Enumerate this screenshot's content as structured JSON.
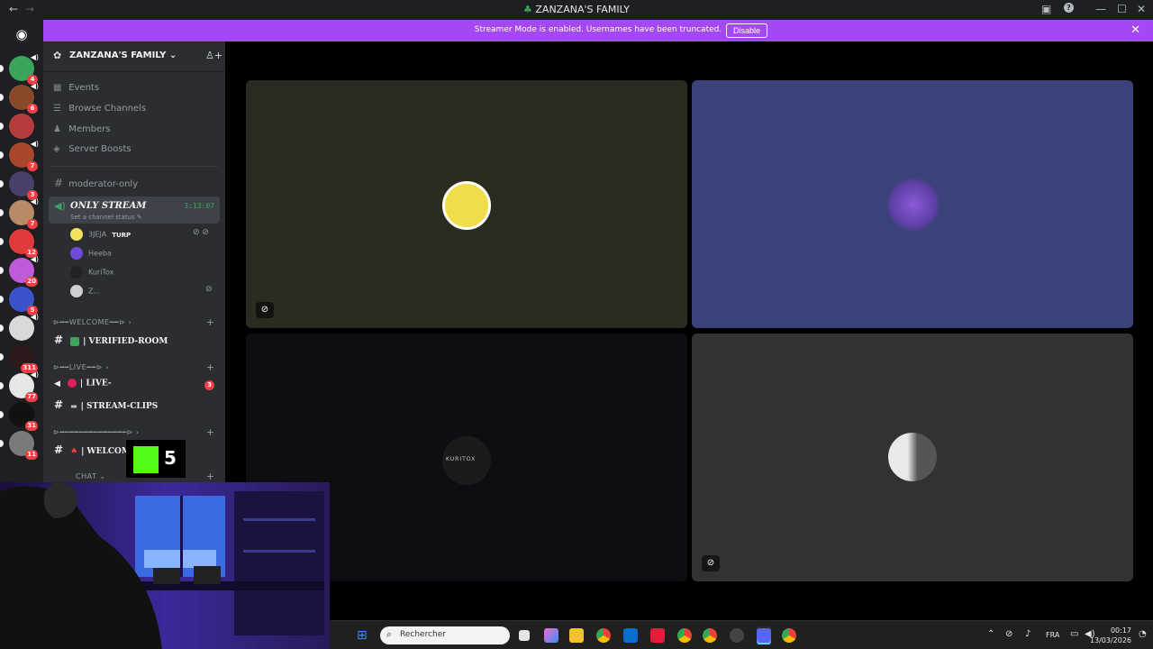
{
  "window": {
    "title": "ZANZANA'S FAMILY",
    "back_icon": "←",
    "forward_icon": "→",
    "help_icon": "?",
    "minimize_icon": "—",
    "maximize_icon": "☐",
    "close_icon": "✕"
  },
  "banner": {
    "message": "Streamer Mode is enabled. Usernames have been truncated.",
    "button": "Disable",
    "close": "✕",
    "color": "#a348f2"
  },
  "servers": [
    {
      "badge": "4",
      "color": "#3ba55c",
      "speaker": true
    },
    {
      "badge": "6",
      "color": "#8a4a2a",
      "speaker": true
    },
    {
      "badge": "",
      "color": "#b43c3c",
      "speaker": false
    },
    {
      "badge": "7",
      "color": "#a8472d",
      "speaker": true
    },
    {
      "badge": "3",
      "color": "#4a3f6b",
      "speaker": false
    },
    {
      "badge": "7",
      "color": "#b88a66",
      "speaker": true
    },
    {
      "badge": "12",
      "color": "#e03a3a",
      "speaker": false
    },
    {
      "badge": "20",
      "color": "#c05ad8",
      "speaker": true
    },
    {
      "badge": "5",
      "color": "#3b52c8",
      "speaker": false
    },
    {
      "badge": "",
      "color": "#d9d9d9",
      "speaker": true
    },
    {
      "badge": "311",
      "color": "#2b1a1a",
      "speaker": false
    },
    {
      "badge": "77",
      "color": "#e6e6e6",
      "speaker": true
    },
    {
      "badge": "31",
      "color": "#111111",
      "speaker": false
    },
    {
      "badge": "11",
      "color": "#7a7a7a",
      "speaker": false
    }
  ],
  "server": {
    "name": "ZANZANA'S FAMILY",
    "chevron": "⌄",
    "menu": [
      {
        "icon": "▦",
        "label": "Events"
      },
      {
        "icon": "☰",
        "label": "Browse Channels"
      },
      {
        "icon": "♟",
        "label": "Members"
      },
      {
        "icon": "◈",
        "label": "Server Boosts"
      }
    ],
    "channels": {
      "moderator": "moderator-only",
      "voice_active": {
        "name": "ONLY STREAM",
        "timer": "3:13:07",
        "status": "Set a channel status"
      },
      "voice_users": [
        {
          "name": "3JEJA",
          "tag": "TURP",
          "color": "#f2e35a",
          "muted": true
        },
        {
          "name": "Heeba",
          "tag": "",
          "color": "#6e4ad8",
          "muted": false
        },
        {
          "name": "KuriTox",
          "tag": "",
          "color": "#222222",
          "muted": false
        },
        {
          "name": "Z...",
          "tag": "",
          "color": "#cfcfcf",
          "muted": true
        }
      ],
      "cat_welcome": "⊳━━WELCOME━━⊳",
      "verified_room": "| VERIFIED-ROOM",
      "cat_live": "⊳━━LIVE━━⊳",
      "live_channel": "| LIVE-",
      "live_badge": "3",
      "stream_clips": "| STREAM-CLIPS",
      "cat_blank": "⊳━━━━━━━━━━━━━━⊳",
      "welcome_chan": "| WELCOM",
      "cat_chat": "CHAT",
      "plus": "+"
    }
  },
  "tiles": [
    {
      "bg": "#2c2b1f",
      "avatar_color": "#f0dd4a",
      "label_image": ""
    },
    {
      "bg": "#3b4179",
      "avatar_color": "#5b3ea3",
      "label_image": ""
    },
    {
      "bg": "#0e0e12",
      "avatar_color": "#1b1b1b",
      "label_image": "KURITOX"
    },
    {
      "bg": "#323232",
      "avatar_color": "#c9c9c9",
      "label_image": ""
    }
  ],
  "kick_overlay": {
    "count": "5"
  },
  "taskbar": {
    "search_placeholder": "Rechercher",
    "lang": "FRA",
    "time": "00:17",
    "date": "13/03/2026"
  }
}
